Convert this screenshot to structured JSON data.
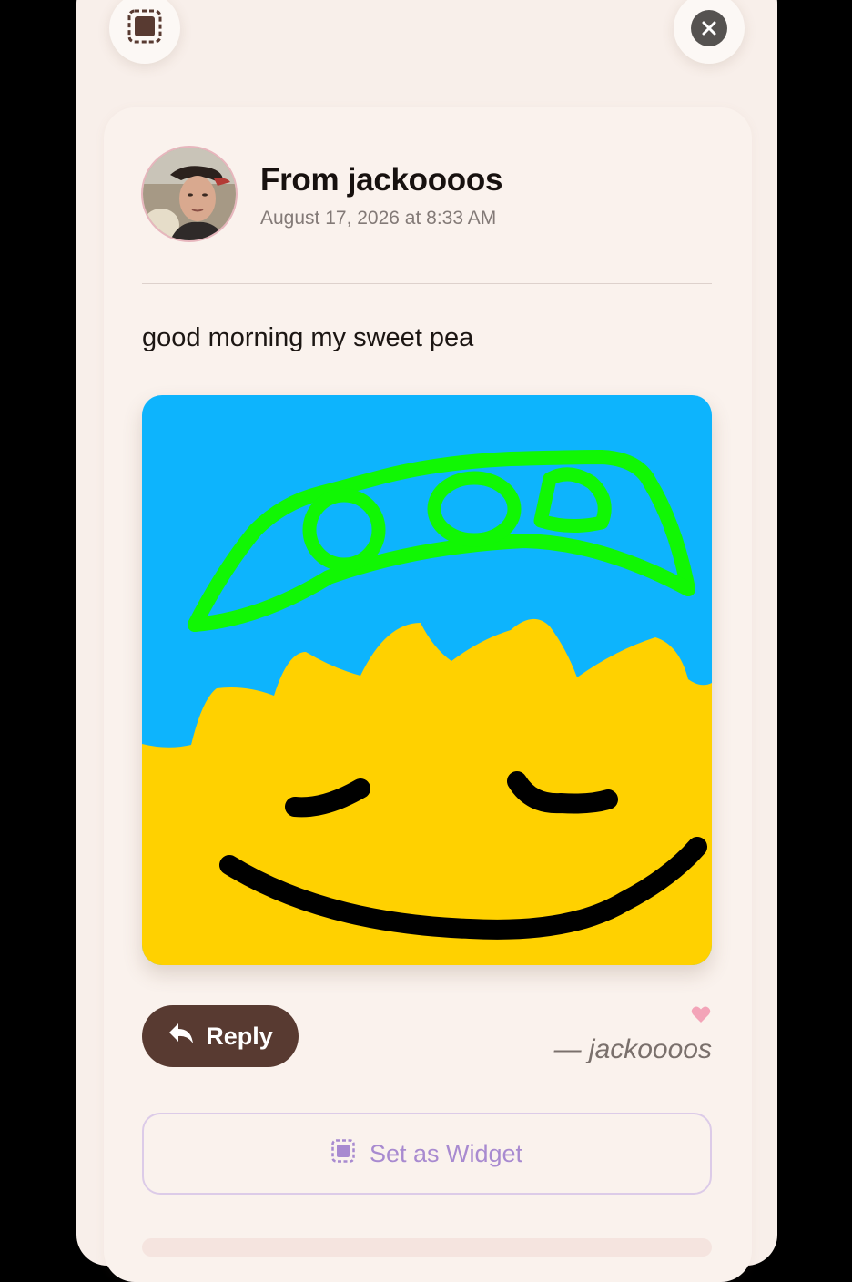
{
  "header": {
    "widget_icon": "widget-frame-icon",
    "close_icon": "close-icon"
  },
  "note": {
    "from_title": "From jackoooos",
    "date": "August 17, 2026 at 8:33 AM",
    "message": "good morning my sweet pea",
    "drawing_colors": {
      "sky": "#0db4fd",
      "face": "#ffd100",
      "pea_pod": "#11f704",
      "ink": "#000000"
    }
  },
  "actions": {
    "reply_label": "Reply",
    "reply_icon": "reply-arrow-icon",
    "heart_icon": "heart-icon",
    "signature": "— jackoooos",
    "widget_label": "Set as Widget",
    "widget_icon": "widget-frame-icon"
  },
  "colors": {
    "reply_button": "#583a31",
    "widget_accent": "#a88ad0",
    "heart": "#f3a4b8",
    "background": "#f8efea"
  }
}
